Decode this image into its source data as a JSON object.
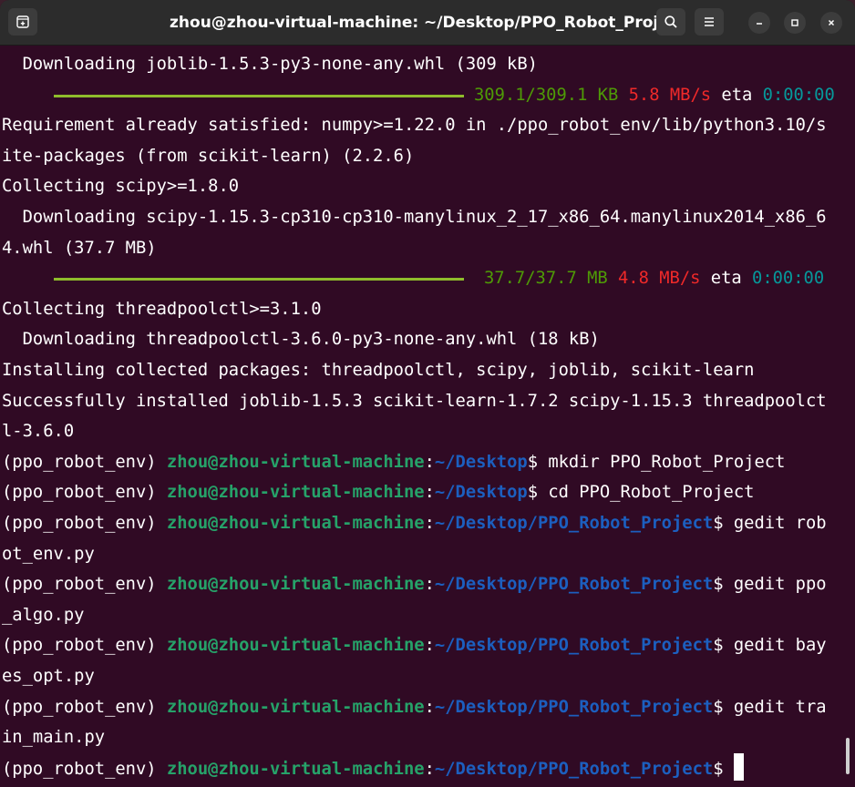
{
  "window": {
    "title": "zhou@zhou-virtual-machine: ~/Desktop/PPO_Robot_Project",
    "icons": [
      "new-tab-icon",
      "search-icon",
      "hamburger-menu-icon",
      "minimize-icon",
      "maximize-icon",
      "close-icon"
    ]
  },
  "terminal": {
    "lines": [
      {
        "text": "  Downloading joblib-1.5.3-py3-none-any.whl (309 kB)"
      },
      {
        "progress": {
          "fraction": 1.0,
          "amount": "309.1/309.1 KB",
          "rate": "5.8 MB/s",
          "eta_label": "eta",
          "eta": "0:00:00"
        }
      },
      {
        "text": "Requirement already satisfied: numpy>=1.22.0 in ./ppo_robot_env/lib/python3.10/s"
      },
      {
        "text": "ite-packages (from scikit-learn) (2.2.6)"
      },
      {
        "text": "Collecting scipy>=1.8.0"
      },
      {
        "text": "  Downloading scipy-1.15.3-cp310-cp310-manylinux_2_17_x86_64.manylinux2014_x86_6"
      },
      {
        "text": "4.whl (37.7 MB)"
      },
      {
        "progress": {
          "fraction": 1.0,
          "amount": "37.7/37.7 MB",
          "rate": "4.8 MB/s",
          "eta_label": "eta",
          "eta": "0:00:00"
        }
      },
      {
        "text": "Collecting threadpoolctl>=3.1.0"
      },
      {
        "text": "  Downloading threadpoolctl-3.6.0-py3-none-any.whl (18 kB)"
      },
      {
        "text": "Installing collected packages: threadpoolctl, scipy, joblib, scikit-learn"
      },
      {
        "text": "Successfully installed joblib-1.5.3 scikit-learn-1.7.2 scipy-1.15.3 threadpoolct"
      },
      {
        "text": "l-3.6.0"
      },
      {
        "prompt": {
          "env": "(ppo_robot_env) ",
          "user": "zhou@zhou-virtual-machine",
          "sep": ":",
          "path": "~/Desktop",
          "sym": "$ ",
          "cmd": "mkdir PPO_Robot_Project"
        }
      },
      {
        "prompt": {
          "env": "(ppo_robot_env) ",
          "user": "zhou@zhou-virtual-machine",
          "sep": ":",
          "path": "~/Desktop",
          "sym": "$ ",
          "cmd": "cd PPO_Robot_Project"
        }
      },
      {
        "prompt": {
          "env": "(ppo_robot_env) ",
          "user": "zhou@zhou-virtual-machine",
          "sep": ":",
          "path": "~/Desktop/PPO_Robot_Project",
          "sym": "$ ",
          "cmd": "gedit rob"
        }
      },
      {
        "text": "ot_env.py"
      },
      {
        "prompt": {
          "env": "(ppo_robot_env) ",
          "user": "zhou@zhou-virtual-machine",
          "sep": ":",
          "path": "~/Desktop/PPO_Robot_Project",
          "sym": "$ ",
          "cmd": "gedit ppo"
        }
      },
      {
        "text": "_algo.py"
      },
      {
        "prompt": {
          "env": "(ppo_robot_env) ",
          "user": "zhou@zhou-virtual-machine",
          "sep": ":",
          "path": "~/Desktop/PPO_Robot_Project",
          "sym": "$ ",
          "cmd": "gedit bay"
        }
      },
      {
        "text": "es_opt.py"
      },
      {
        "prompt": {
          "env": "(ppo_robot_env) ",
          "user": "zhou@zhou-virtual-machine",
          "sep": ":",
          "path": "~/Desktop/PPO_Robot_Project",
          "sym": "$ ",
          "cmd": "gedit tra"
        }
      },
      {
        "text": "in_main.py"
      },
      {
        "prompt": {
          "env": "(ppo_robot_env) ",
          "user": "zhou@zhou-virtual-machine",
          "sep": ":",
          "path": "~/Desktop/PPO_Robot_Project",
          "sym": "$ ",
          "cmd": ""
        },
        "cursor": true
      }
    ]
  },
  "colors": {
    "background": "#300a24",
    "progress_bar": "#8fbc2c",
    "user": "#26a269",
    "path": "#1c5fbf",
    "rate": "#ef2929",
    "eta": "#06989a"
  }
}
